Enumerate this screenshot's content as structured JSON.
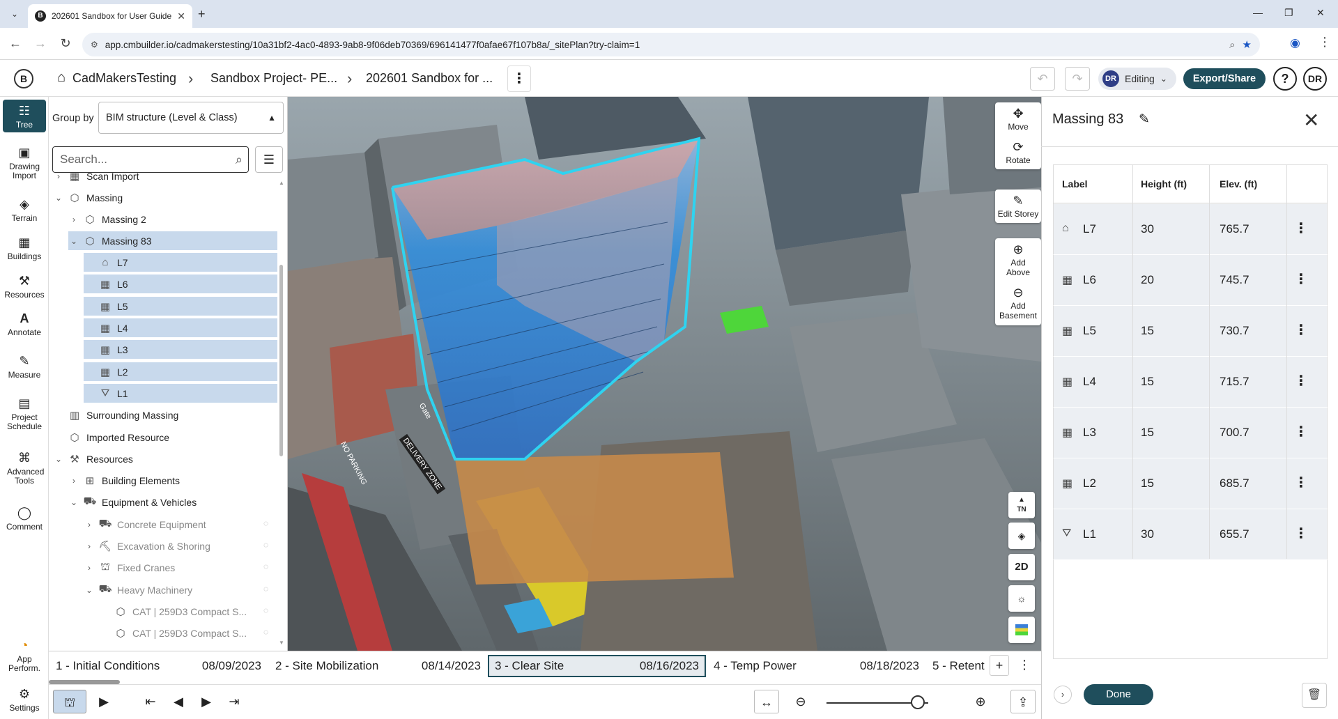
{
  "browser": {
    "tab_title": "202601 Sandbox for User Guide",
    "tab_favicon": "B",
    "url": "app.cmbuilder.io/cadmakerstesting/10a31bf2-4ac0-4893-9ab8-9f06deb70369/696141477f0afae67f107b8a/_sitePlan?try-claim=1",
    "site_info_icon": "tune-icon"
  },
  "header": {
    "logo": "B",
    "breadcrumbs": [
      "CadMakersTesting",
      "Sandbox Project- PE...",
      "202601 Sandbox for ..."
    ],
    "mode_avatar": "DR",
    "mode_label": "Editing",
    "export_label": "Export/Share",
    "help_label": "?",
    "user_initials": "DR"
  },
  "rail": {
    "items": [
      {
        "label": "Tree",
        "icon": "tree-icon"
      },
      {
        "label": "Drawing Import",
        "icon": "image-icon"
      },
      {
        "label": "Terrain",
        "icon": "terrain-icon"
      },
      {
        "label": "Buildings",
        "icon": "building-icon"
      },
      {
        "label": "Resources",
        "icon": "resources-icon"
      },
      {
        "label": "Annotate",
        "icon": "annotate-icon"
      },
      {
        "label": "Measure",
        "icon": "ruler-icon"
      },
      {
        "label": "Project Schedule",
        "icon": "calendar-icon"
      },
      {
        "label": "Advanced Tools",
        "icon": "tools-icon"
      },
      {
        "label": "Comment",
        "icon": "comment-icon"
      }
    ],
    "bottom": [
      {
        "label": "App Perform.",
        "icon": "performance-icon"
      },
      {
        "label": "Settings",
        "icon": "gear-icon"
      }
    ]
  },
  "tree": {
    "group_by_label": "Group by",
    "group_by_value": "BIM structure (Level & Class)",
    "search_placeholder": "Search...",
    "rows": [
      {
        "label": "Scan Import",
        "chevron": "›"
      },
      {
        "label": "Massing",
        "chevron": "⌄"
      },
      {
        "label": "Massing 2",
        "chevron": "›"
      },
      {
        "label": "Massing 83",
        "chevron": "⌄"
      },
      {
        "label": "L7",
        "chevron": ""
      },
      {
        "label": "L6",
        "chevron": ""
      },
      {
        "label": "L5",
        "chevron": ""
      },
      {
        "label": "L4",
        "chevron": ""
      },
      {
        "label": "L3",
        "chevron": ""
      },
      {
        "label": "L2",
        "chevron": ""
      },
      {
        "label": "L1",
        "chevron": ""
      },
      {
        "label": "Surrounding Massing",
        "chevron": ""
      },
      {
        "label": "Imported Resource",
        "chevron": ""
      },
      {
        "label": "Resources",
        "chevron": "⌄"
      },
      {
        "label": "Building Elements",
        "chevron": "›"
      },
      {
        "label": "Equipment & Vehicles",
        "chevron": "⌄"
      },
      {
        "label": "Concrete Equipment",
        "chevron": "›"
      },
      {
        "label": "Excavation & Shoring",
        "chevron": "›"
      },
      {
        "label": "Fixed Cranes",
        "chevron": "›"
      },
      {
        "label": "Heavy Machinery",
        "chevron": "⌄"
      },
      {
        "label": "CAT | 259D3 Compact S...",
        "chevron": ""
      },
      {
        "label": "CAT | 259D3 Compact S...",
        "chevron": ""
      }
    ]
  },
  "viewport": {
    "tools": [
      {
        "label": "Move",
        "icon": "move-icon"
      },
      {
        "label": "Rotate",
        "icon": "rotate-icon"
      },
      {
        "label": "Edit Storey",
        "icon": "edit-storey-icon"
      },
      {
        "label": "Add Above",
        "icon": "add-above-icon"
      },
      {
        "label": "Add Basement",
        "icon": "add-basement-icon"
      }
    ],
    "view_controls": [
      {
        "label": "TN",
        "icon": "north-arrow-icon"
      },
      {
        "label": "",
        "icon": "layers-icon"
      },
      {
        "label": "2D",
        "icon": "view-2d-icon"
      },
      {
        "label": "",
        "icon": "sun-icon"
      },
      {
        "label": "",
        "icon": "color-legend-icon"
      }
    ],
    "ground_labels": [
      "NO PARKING",
      "DELIVERY ZONE",
      "Gate"
    ]
  },
  "timeline": {
    "phases": [
      {
        "name": "1 - Initial Conditions",
        "date": "08/09/2023"
      },
      {
        "name": "2 - Site Mobilization",
        "date": "08/14/2023"
      },
      {
        "name": "3 - Clear Site",
        "date": "08/16/2023"
      },
      {
        "name": "4 - Temp Power",
        "date": "08/18/2023"
      },
      {
        "name": "5 - Retent",
        "date": ""
      }
    ],
    "active_phase": "3 - Clear Site",
    "add_label": "+",
    "more_label": "⋮"
  },
  "bottom_bar": {
    "zoom_level": 0.9
  },
  "props": {
    "title": "Massing 83",
    "columns": [
      "Label",
      "Height (ft)",
      "Elev. (ft)"
    ],
    "levels": [
      {
        "label": "L7",
        "height": "30",
        "elev": "765.7",
        "icon": "roof-icon"
      },
      {
        "label": "L6",
        "height": "20",
        "elev": "745.7",
        "icon": "floor-grid-icon"
      },
      {
        "label": "L5",
        "height": "15",
        "elev": "730.7",
        "icon": "floor-grid-icon"
      },
      {
        "label": "L4",
        "height": "15",
        "elev": "715.7",
        "icon": "floor-grid-icon"
      },
      {
        "label": "L3",
        "height": "15",
        "elev": "700.7",
        "icon": "floor-grid-icon"
      },
      {
        "label": "L2",
        "height": "15",
        "elev": "685.7",
        "icon": "floor-grid-icon"
      },
      {
        "label": "L1",
        "height": "30",
        "elev": "655.7",
        "icon": "ground-floor-icon"
      }
    ],
    "done_label": "Done"
  },
  "colors": {
    "brand": "#1f4e5c",
    "selection": "#c8d9ec",
    "massing_outline": "#2fd3f0",
    "massing_fill": "#2f8fe0"
  }
}
